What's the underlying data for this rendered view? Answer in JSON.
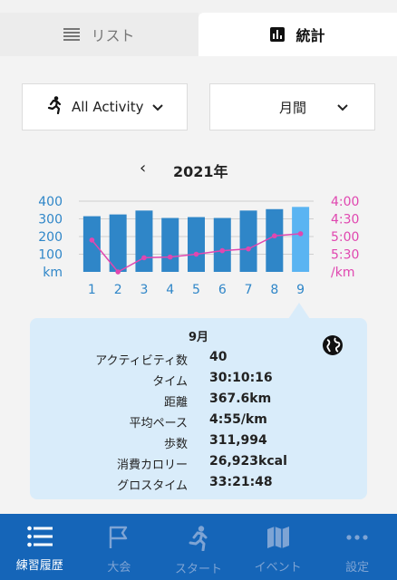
{
  "tabs": [
    {
      "label": "リスト",
      "icon": "list-icon",
      "active": false
    },
    {
      "label": "統計",
      "icon": "bar-chart-icon",
      "active": true
    }
  ],
  "filters": {
    "activity": {
      "label": "All Activity",
      "icon": "runner-icon"
    },
    "period": {
      "label": "月間"
    }
  },
  "year_nav": {
    "prev": "‹",
    "label": "2021年"
  },
  "chart_data": {
    "type": "bar",
    "categories": [
      "1",
      "2",
      "3",
      "4",
      "5",
      "6",
      "7",
      "8",
      "9"
    ],
    "series": [
      {
        "values": [
          315,
          325,
          347,
          305,
          310,
          305,
          347,
          355,
          367.6
        ],
        "axis": "left",
        "color": "#2f86c8",
        "selected_color": "#5ab4f2"
      },
      {
        "values": [
          5.1,
          6.0,
          5.6,
          5.58,
          5.5,
          5.4,
          5.35,
          4.98,
          4.92
        ],
        "axis": "right",
        "color": "#e047b0"
      }
    ],
    "left_axis": {
      "ticks": [
        "400",
        "300",
        "200",
        "100"
      ],
      "unit": "km",
      "ylim": [
        0,
        400
      ],
      "color": "#2f86c8"
    },
    "right_axis": {
      "ticks": [
        "4:00",
        "4:30",
        "5:00",
        "5:30"
      ],
      "unit": "/km",
      "ylim_minutes": [
        4,
        6
      ],
      "color": "#e047b0"
    },
    "selected_index": 8
  },
  "popup": {
    "title": "9月",
    "globe_icon": "globe-icon",
    "stats": [
      {
        "label": "アクティビティ数",
        "value": "40"
      },
      {
        "label": "タイム",
        "value": "30:10:16"
      },
      {
        "label": "距離",
        "value": "367.6km"
      },
      {
        "label": "平均ペース",
        "value": "4:55/km"
      },
      {
        "label": "歩数",
        "value": "311,994"
      },
      {
        "label": "消費カロリー",
        "value": "26,923kcal"
      },
      {
        "label": "グロスタイム",
        "value": "33:21:48"
      }
    ]
  },
  "bottom_nav": [
    {
      "label": "練習履歴",
      "icon": "list-icon",
      "active": true
    },
    {
      "label": "大会",
      "icon": "flag-icon",
      "active": false
    },
    {
      "label": "スタート",
      "icon": "runner-icon",
      "active": false
    },
    {
      "label": "イベント",
      "icon": "map-icon",
      "active": false
    },
    {
      "label": "設定",
      "icon": "more-icon",
      "active": false
    }
  ]
}
